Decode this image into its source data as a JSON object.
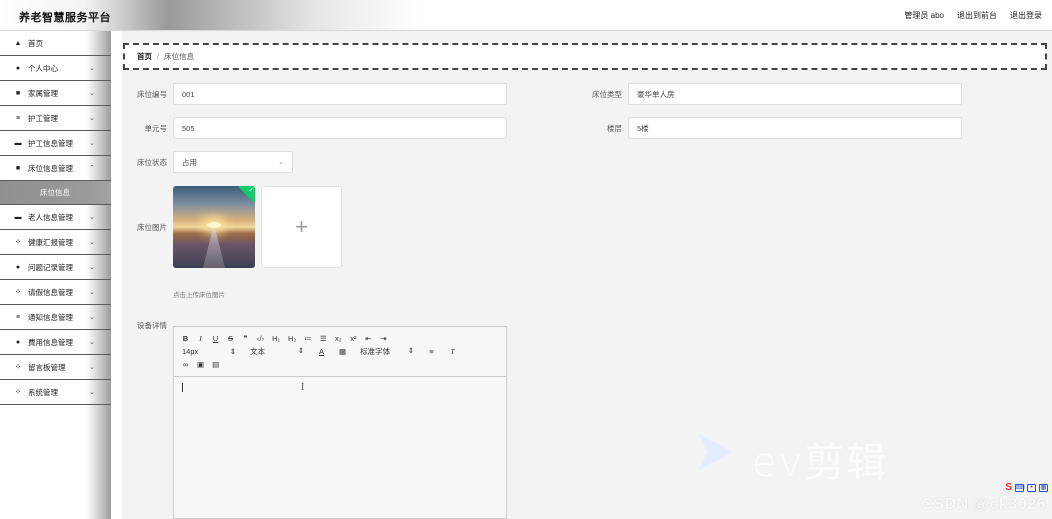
{
  "app": {
    "title": "养老智慧服务平台"
  },
  "topnav": {
    "admin": "管理员 abo",
    "frontend": "退出到前台",
    "logout": "退出登录"
  },
  "sidebar": {
    "items": [
      {
        "label": "首页",
        "icon": "home-icon"
      },
      {
        "label": "个人中心",
        "icon": "user-icon"
      },
      {
        "label": "家属管理",
        "icon": "id-card-icon"
      },
      {
        "label": "护工管理",
        "icon": "list-icon"
      },
      {
        "label": "护工信息管理",
        "icon": "monitor-icon"
      },
      {
        "label": "床位信息管理",
        "icon": "bed-icon"
      },
      {
        "label": "床位信息",
        "icon": ""
      },
      {
        "label": "老人信息管理",
        "icon": "monitor-icon"
      },
      {
        "label": "健康汇报管理",
        "icon": "grid-icon"
      },
      {
        "label": "问题记录管理",
        "icon": "user-icon"
      },
      {
        "label": "请假信息管理",
        "icon": "grid-icon"
      },
      {
        "label": "通知信息管理",
        "icon": "list-icon"
      },
      {
        "label": "費用信息管理",
        "icon": "user-icon"
      },
      {
        "label": "留言板管理",
        "icon": "grid-icon"
      },
      {
        "label": "系统管理",
        "icon": "grid-icon"
      }
    ]
  },
  "breadcrumb": {
    "home": "首页",
    "separator": "/",
    "current": "床位信息"
  },
  "form": {
    "bed_no": {
      "label": "床位编号",
      "value": "001"
    },
    "bed_type": {
      "label": "床位类型",
      "value": "豪华单人房"
    },
    "unit": {
      "label": "单元号",
      "value": "505"
    },
    "floor": {
      "label": "楼层",
      "value": "5楼"
    },
    "status": {
      "label": "床位状态",
      "value": "占用"
    },
    "image": {
      "label": "床位图片",
      "plus": "+",
      "hint": "点击上传床位图片"
    },
    "details": {
      "label": "设备详情"
    }
  },
  "editor": {
    "row1": [
      "B",
      "I",
      "U",
      "S",
      "❞",
      "‹/›",
      "H₁",
      "H₂",
      "≔",
      "☰",
      "x₂",
      "x²",
      "⇤",
      "⇥"
    ],
    "font_size": "14px",
    "block": "文本",
    "font_family": "标准字体",
    "caret_glyph": "I"
  },
  "watermark": {
    "text": "CSDN @ck3026",
    "ev": "ev剪辑"
  },
  "colors": {
    "success": "#13ce66",
    "sidebar_active": "#9b9b9b"
  }
}
